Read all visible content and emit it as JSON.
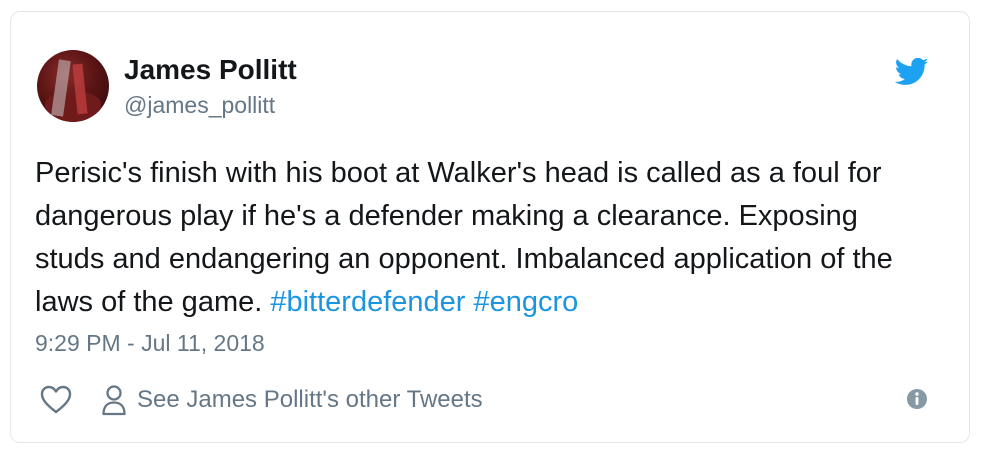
{
  "author": {
    "name": "James Pollitt",
    "handle": "@james_pollitt"
  },
  "tweet": {
    "text": "Perisic's finish with his boot at Walker's head is called as a foul for dangerous play if he's a defender making a clearance. Exposing studs and endangering an opponent. Imbalanced application of the laws of the game. ",
    "hashtags": [
      "#bitterdefender",
      "#engcro"
    ],
    "timestamp": "9:29 PM - Jul 11, 2018"
  },
  "actions": {
    "other_tweets_label": "See James Pollitt's other Tweets"
  },
  "icons": {
    "brand": "twitter-bird-icon",
    "like": "heart-icon",
    "profile": "person-icon",
    "info": "info-icon"
  },
  "colors": {
    "brand": "#1da1f2",
    "hashtag": "#1b95e0",
    "text": "#14171a",
    "muted": "#657786",
    "border": "#e1e8ed"
  }
}
